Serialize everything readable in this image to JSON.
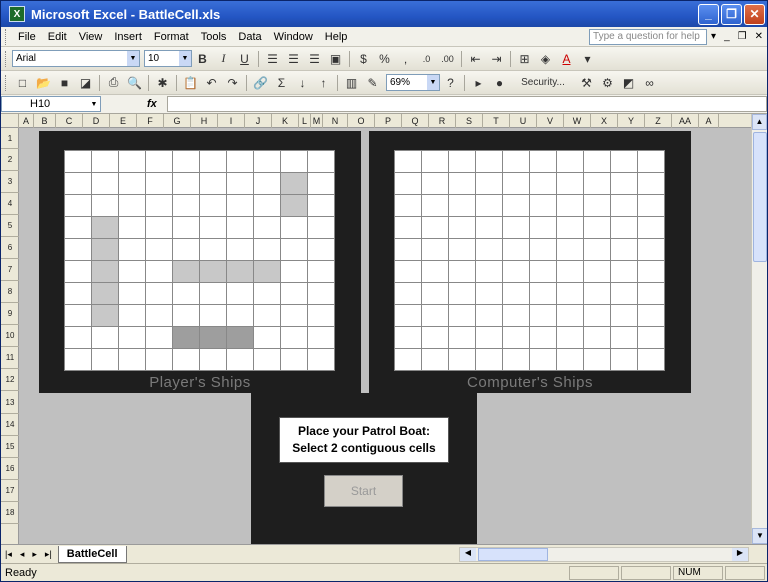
{
  "window": {
    "title": "Microsoft Excel - BattleCell.xls",
    "app_icon": "X"
  },
  "menu": {
    "items": [
      "File",
      "Edit",
      "View",
      "Insert",
      "Format",
      "Tools",
      "Data",
      "Window",
      "Help"
    ],
    "help_placeholder": "Type a question for help"
  },
  "format_toolbar": {
    "font": "Arial",
    "size": "10",
    "percent": "%",
    "comma": ",",
    "currency": "$"
  },
  "standard_toolbar": {
    "zoom": "69%",
    "security": "Security..."
  },
  "formula_bar": {
    "name_box": "H10",
    "fx": "fx",
    "value": ""
  },
  "columns": [
    "A",
    "B",
    "C",
    "D",
    "E",
    "F",
    "G",
    "H",
    "I",
    "J",
    "K",
    "L",
    "M",
    "N",
    "O",
    "P",
    "Q",
    "R",
    "S",
    "T",
    "U",
    "V",
    "W",
    "X",
    "Y",
    "Z",
    "AA",
    "A"
  ],
  "rows": [
    "1",
    "2",
    "3",
    "4",
    "5",
    "6",
    "7",
    "8",
    "9",
    "10",
    "11",
    "12",
    "13",
    "14",
    "15",
    "16",
    "17",
    "18"
  ],
  "player_board": {
    "label": "Player's Ships",
    "ship_cells": [
      [
        1,
        8
      ],
      [
        2,
        8
      ],
      [
        3,
        1
      ],
      [
        4,
        1
      ],
      [
        5,
        1
      ],
      [
        6,
        1
      ],
      [
        7,
        1
      ],
      [
        5,
        4
      ],
      [
        5,
        5
      ],
      [
        5,
        6
      ],
      [
        5,
        7
      ]
    ],
    "selected_cells": [
      [
        8,
        4
      ],
      [
        8,
        5
      ],
      [
        8,
        6
      ]
    ]
  },
  "computer_board": {
    "label": "Computer's Ships"
  },
  "message": {
    "line1": "Place your Patrol Boat:",
    "line2": "Select 2 contiguous cells",
    "start_label": "Start"
  },
  "sheet_tab": "BattleCell",
  "status": {
    "ready": "Ready",
    "num": "NUM"
  }
}
